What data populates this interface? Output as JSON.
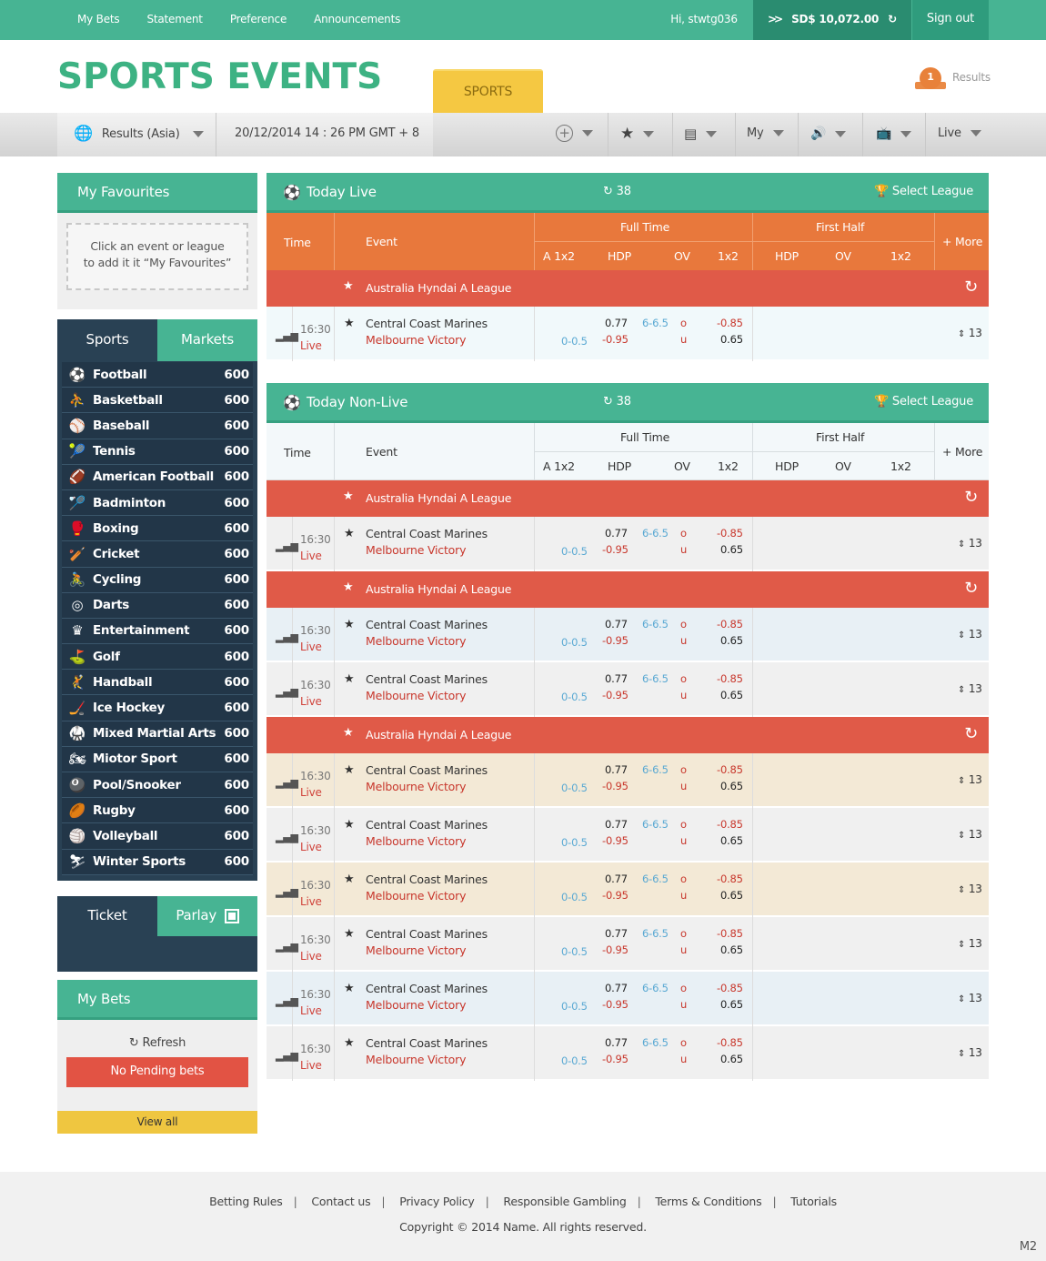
{
  "topnav": {
    "items": [
      "My Bets",
      "Statement",
      "Preference",
      "Announcements"
    ],
    "greeting": "Hi, stwtg036",
    "balance": "SD$  10,072.00",
    "signout": "Sign out"
  },
  "brand": {
    "title": "SPORTS EVENTS",
    "tab": "SPORTS",
    "results_count": "1",
    "results_label": "Results"
  },
  "toolbar": {
    "market": "Results (Asia)",
    "datetime": "20/12/2014  14 : 26 PM   GMT + 8",
    "my": "My",
    "live": "Live"
  },
  "favourites": {
    "title": "My Favourites",
    "hint_line1": "Click an event or league",
    "hint_line2": "to add it it “My Favourites”"
  },
  "sport_tabs": {
    "sports": "Sports",
    "markets": "Markets"
  },
  "sports": [
    {
      "name": "Football",
      "count": "600",
      "icon": "⚽"
    },
    {
      "name": "Basketball",
      "count": "600",
      "icon": "⛹"
    },
    {
      "name": "Baseball",
      "count": "600",
      "icon": "⚾"
    },
    {
      "name": "Tennis",
      "count": "600",
      "icon": "🎾"
    },
    {
      "name": "American Football",
      "count": "600",
      "icon": "🏈"
    },
    {
      "name": "Badminton",
      "count": "600",
      "icon": "🏸"
    },
    {
      "name": "Boxing",
      "count": "600",
      "icon": "🥊"
    },
    {
      "name": "Cricket",
      "count": "600",
      "icon": "🏏"
    },
    {
      "name": "Cycling",
      "count": "600",
      "icon": "🚴"
    },
    {
      "name": "Darts",
      "count": "600",
      "icon": "◎"
    },
    {
      "name": "Entertainment",
      "count": "600",
      "icon": "♛"
    },
    {
      "name": "Golf",
      "count": "600",
      "icon": "⛳"
    },
    {
      "name": "Handball",
      "count": "600",
      "icon": "🤾"
    },
    {
      "name": "Ice Hockey",
      "count": "600",
      "icon": "🏒"
    },
    {
      "name": "Mixed Martial Arts",
      "count": "600",
      "icon": "🥋"
    },
    {
      "name": "Miotor Sport",
      "count": "600",
      "icon": "🏍"
    },
    {
      "name": "Pool/Snooker",
      "count": "600",
      "icon": "🎱"
    },
    {
      "name": "Rugby",
      "count": "600",
      "icon": "🏉"
    },
    {
      "name": "Volleyball",
      "count": "600",
      "icon": "🏐"
    },
    {
      "name": "Winter Sports",
      "count": "600",
      "icon": "⛷"
    }
  ],
  "ticket_tabs": {
    "ticket": "Ticket",
    "parlay": "Parlay"
  },
  "mybets": {
    "title": "My Bets",
    "refresh": "Refresh",
    "no_pending": "No Pending bets",
    "view_all": "View all"
  },
  "columns": {
    "time": "Time",
    "event": "Event",
    "full_time": "Full Time",
    "first_half": "First Half",
    "more": "+ More",
    "a1x2": "A 1x2",
    "hdp": "HDP",
    "ov": "OV",
    "x12": "1x2",
    "hdp2": "HDP",
    "ov2": "OV",
    "x12b": "1x2"
  },
  "sections": {
    "live_title": "Today Live",
    "nonlive_title": "Today Non-Live",
    "count": "38",
    "select_league": "Select League"
  },
  "league_name": "Australia Hyndai A League",
  "match": {
    "time": "16:30",
    "status": "Live",
    "home": "Central Coast Marines",
    "away": "Melbourne Victory",
    "hdp_top": "0.77",
    "hdp_line": "0-0.5",
    "hdp_bottom": "-0.95",
    "ou_line": "6-6.5",
    "over": "o",
    "under": "u",
    "x12_top": "-0.85",
    "x12_bottom": "0.65",
    "more_count": "13"
  },
  "colors": {
    "green": "#47b493",
    "dark": "#294154",
    "orange": "#e8783c",
    "red": "#e05a48",
    "yellow": "#f5c842"
  },
  "footer": {
    "links": [
      "Betting Rules",
      "Contact us",
      "Privacy Policy",
      "Responsible Gambling",
      "Terms & Conditions",
      "Tutorials"
    ],
    "copyright": "Copyright  ©  2014  Name.   All rights reserved.",
    "code": "M2"
  }
}
